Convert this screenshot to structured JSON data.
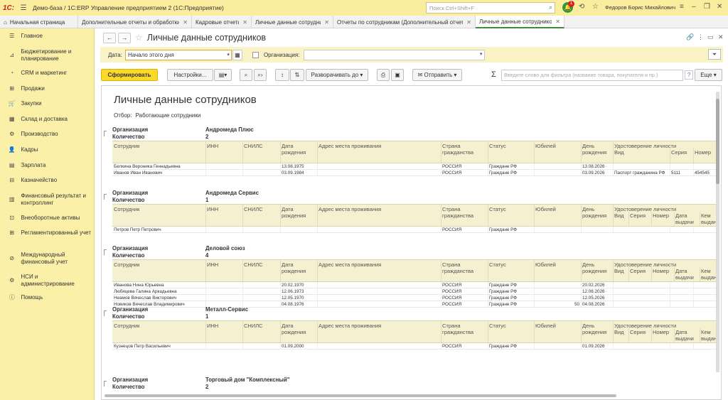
{
  "titlebar": {
    "logo": "1С:",
    "app_title": "Демо-база / 1С:ERP Управление предприятием 2  (1С:Предприятие)",
    "search_placeholder": "Поиск Ctrl+Shift+F",
    "notifications": "1",
    "user": "Федоров Борис Михайлович"
  },
  "tabs": [
    {
      "label": "Начальная страница",
      "close": false
    },
    {
      "label": "Дополнительные отчеты и обработки",
      "close": true
    },
    {
      "label": "Кадровые отчеты",
      "close": true
    },
    {
      "label": "Личные данные сотрудников",
      "close": true
    },
    {
      "label": "Отчеты по сотрудникам (Дополнительный отчет)",
      "close": true
    },
    {
      "label": "Личные данные сотрудников",
      "close": true
    }
  ],
  "sidebar": {
    "items": [
      "Главное",
      "Бюджетирование и планирование",
      "CRM и маркетинг",
      "Продажи",
      "Закупки",
      "Склад и доставка",
      "Производство",
      "Кадры",
      "Зарплата",
      "Казначейство",
      "Финансовый результат и контроллинг",
      "Внеоборотные активы",
      "Регламентированный учет",
      "Международный финансовый учет",
      "НСИ и администрирование",
      "Помощь"
    ]
  },
  "page": {
    "title": "Личные данные сотрудников"
  },
  "filters": {
    "date_label": "Дата:",
    "date_value": "Начало этого дня",
    "org_label": "Организация:"
  },
  "toolbar": {
    "generate": "Сформировать",
    "settings": "Настройки...",
    "expand": "Разворачивать до",
    "send": "Отправить",
    "filter_placeholder": "Введите слово для фильтра (название товара, покупателя и пр.)",
    "more": "Еще"
  },
  "report": {
    "title": "Личные данные сотрудников",
    "filter_label": "Отбор:",
    "filter_value": "Работающие сотрудники",
    "org_label": "Организация",
    "count_label": "Количество",
    "columns": {
      "employee": "Сотрудник",
      "inn": "ИНН",
      "snils": "СНИЛС",
      "birth": "Дата рождения",
      "address": "Адрес места проживания",
      "country": "Страна гражданства",
      "status": "Статус",
      "jubilee": "Юбилей",
      "birthday": "День рождения",
      "id_doc": "Удостоверение личности",
      "id_type": "Вид",
      "id_series": "Серия",
      "id_number": "Номер",
      "id_date": "Дата выдачи",
      "id_issuer": "Кем выдан"
    },
    "groups": [
      {
        "org": "Андромеда Плюс",
        "count": "2",
        "rows": [
          {
            "name": "Белкина Вероника Геннадьевна",
            "birth": "13.08.1975",
            "country": "РОССИЯ",
            "status": "Граждане РФ",
            "jubilee": "",
            "birthday": "13.08.2026",
            "id_type": "",
            "id_series": "",
            "id_number": ""
          },
          {
            "name": "Иванов Иван Иванович",
            "birth": "03.09.1984",
            "country": "РОССИЯ",
            "status": "Граждане РФ",
            "jubilee": "",
            "birthday": "03.09.2026",
            "id_type": "Паспорт гражданина РФ",
            "id_series": "5111",
            "id_number": "454545"
          }
        ]
      },
      {
        "org": "Андромеда Сервис",
        "count": "1",
        "rows": [
          {
            "name": "Петров Петр Петрович",
            "birth": "",
            "country": "РОССИЯ",
            "status": "Граждане РФ",
            "jubilee": "",
            "birthday": "",
            "id_type": "",
            "id_series": "",
            "id_number": ""
          }
        ]
      },
      {
        "org": "Деловой союз",
        "count": "4",
        "rows": [
          {
            "name": "Иванова Нина Юрьевна",
            "birth": "20.02.1970",
            "country": "РОССИЯ",
            "status": "Граждане РФ",
            "jubilee": "",
            "birthday": "20.02.2026",
            "id_type": "",
            "id_series": "",
            "id_number": ""
          },
          {
            "name": "Любяцева Галина Аркадьевна",
            "birth": "12.06.1973",
            "country": "РОССИЯ",
            "status": "Граждане РФ",
            "jubilee": "",
            "birthday": "12.06.2026",
            "id_type": "",
            "id_series": "",
            "id_number": ""
          },
          {
            "name": "Неамов Вячеслав Викторович",
            "birth": "12.05.1970",
            "country": "РОССИЯ",
            "status": "Граждане РФ",
            "jubilee": "",
            "birthday": "12.05.2026",
            "id_type": "",
            "id_series": "",
            "id_number": ""
          },
          {
            "name": "Новиков Вячеслав Владимирович",
            "birth": "04.08.1976",
            "country": "РОССИЯ",
            "status": "Граждане РФ",
            "jubilee": "50",
            "birthday": "04.08.2026",
            "id_type": "",
            "id_series": "",
            "id_number": ""
          }
        ]
      },
      {
        "org": "Металл-Сервис",
        "count": "1",
        "rows": [
          {
            "name": "Кузнецов Петр Васильевич",
            "birth": "01.09.2000",
            "country": "РОССИЯ",
            "status": "Граждане РФ",
            "jubilee": "",
            "birthday": "01.09.2026",
            "id_type": "",
            "id_series": "",
            "id_number": ""
          }
        ]
      },
      {
        "org": "Торговый дом \"Комплексный\"",
        "count": "2",
        "rows": []
      }
    ]
  }
}
